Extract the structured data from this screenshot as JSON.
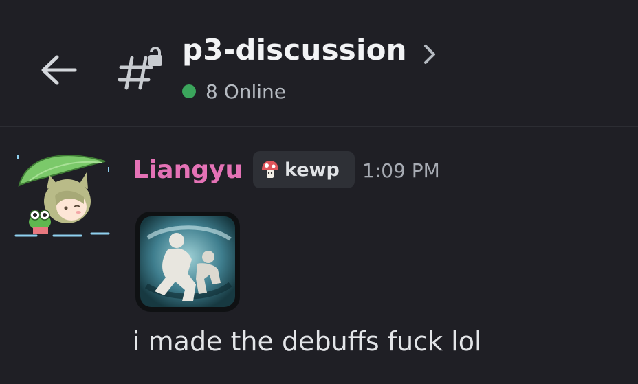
{
  "header": {
    "channel_name": "p3-discussion",
    "online_count": "8 Online",
    "status_color": "#3ba55c",
    "icons": [
      "back-arrow-icon",
      "locked-channel-hash-icon",
      "chevron-right-icon"
    ]
  },
  "message": {
    "author": "Liangyu",
    "author_color": "#e472b6",
    "tag_label": "kewp",
    "tag_icon": "mushroom-icon",
    "timestamp": "1:09 PM",
    "attachment": "emoji-image-debuff-icon",
    "text": "i made the debuffs fuck lol"
  }
}
